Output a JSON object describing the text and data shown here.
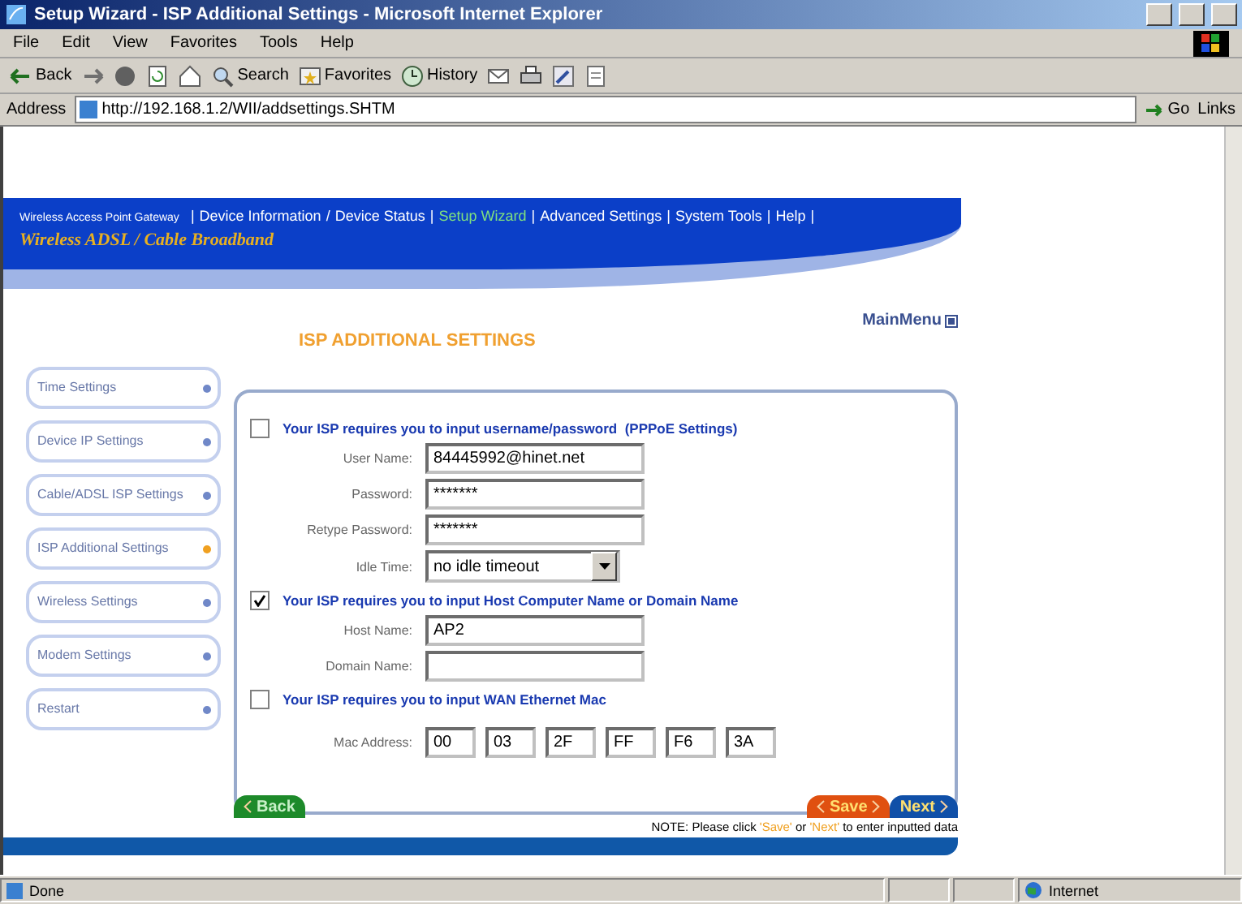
{
  "window": {
    "title": "Setup Wizard - ISP Additional Settings - Microsoft Internet Explorer"
  },
  "menu_bar": [
    "File",
    "Edit",
    "View",
    "Favorites",
    "Tools",
    "Help"
  ],
  "toolbar": [
    {
      "kind": "back",
      "label": "Back"
    },
    {
      "kind": "forward"
    },
    {
      "kind": "stop"
    },
    {
      "kind": "refresh"
    },
    {
      "kind": "home"
    },
    {
      "kind": "search",
      "label": "Search"
    },
    {
      "kind": "favorites",
      "label": "Favorites"
    },
    {
      "kind": "history",
      "label": "History"
    },
    {
      "kind": "mail"
    },
    {
      "kind": "print"
    },
    {
      "kind": "edit"
    },
    {
      "kind": "discuss"
    }
  ],
  "address_bar": {
    "label": "Address",
    "url": "http://192.168.1.2/WII/addsettings.SHTM",
    "go": "Go",
    "links": "Links"
  },
  "banner": {
    "product": "Wireless Access Point Gateway",
    "brand": "Wireless ADSL / Cable Broadband",
    "trailing": "|",
    "nav": [
      {
        "sep": "|",
        "label": "Device Information",
        "selected": false
      },
      {
        "sep": "/",
        "label": "Device Status",
        "selected": false
      },
      {
        "sep": "|",
        "label": "Setup Wizard",
        "selected": true
      },
      {
        "sep": "|",
        "label": "Advanced Settings",
        "selected": false
      },
      {
        "sep": "|",
        "label": "System Tools",
        "selected": false
      },
      {
        "sep": "|",
        "label": "Help",
        "selected": false
      }
    ]
  },
  "page_title": "ISP ADDITIONAL SETTINGS",
  "main_menu": "MainMenu",
  "sidebar": {
    "items": [
      {
        "label": "Time Settings",
        "selected": false
      },
      {
        "label": "Device IP Settings",
        "selected": false
      },
      {
        "label": "Cable/ADSL ISP Settings",
        "selected": false
      },
      {
        "label": "ISP Additional Settings",
        "selected": true
      },
      {
        "label": "Wireless Settings",
        "selected": false
      },
      {
        "label": "Modem Settings",
        "selected": false
      },
      {
        "label": "Restart",
        "selected": false
      }
    ]
  },
  "sections": [
    {
      "label": "Your ISP requires you to input username/password  (PPPoE Settings)",
      "checked": false,
      "fields": [
        {
          "kind": "text",
          "label": "User Name:",
          "value": "84445992@hinet.net"
        },
        {
          "kind": "text",
          "label": "Password:",
          "value": "*******"
        },
        {
          "kind": "text",
          "label": "Retype Password:",
          "value": "*******"
        },
        {
          "kind": "select",
          "label": "Idle Time:",
          "value": "no idle timeout"
        }
      ]
    },
    {
      "label": "Your ISP requires you to input Host Computer Name or Domain Name",
      "checked": true,
      "fields": [
        {
          "kind": "text",
          "label": "Host Name:",
          "value": "AP2"
        },
        {
          "kind": "text",
          "label": "Domain Name:"
        }
      ]
    },
    {
      "label": "Your ISP requires you to input WAN Ethernet Mac",
      "checked": false,
      "fields": [
        {
          "kind": "mac",
          "label": "Mac Address:",
          "values": [
            "00",
            "03",
            "2F",
            "FF",
            "F6",
            "3A"
          ]
        }
      ]
    }
  ],
  "buttons": [
    {
      "kind": "back",
      "label": "Back"
    },
    {
      "kind": "save",
      "label": "Save"
    },
    {
      "kind": "next",
      "label": "Next"
    }
  ],
  "note": [
    {
      "text": "NOTE: Please click ",
      "highlight": false
    },
    {
      "text": "'Save'",
      "highlight": true
    },
    {
      "text": " or ",
      "highlight": false
    },
    {
      "text": "'Next'",
      "highlight": true
    },
    {
      "text": " to enter inputted data",
      "highlight": false
    }
  ],
  "status_bar": {
    "text": "Done",
    "zone": "Internet"
  }
}
